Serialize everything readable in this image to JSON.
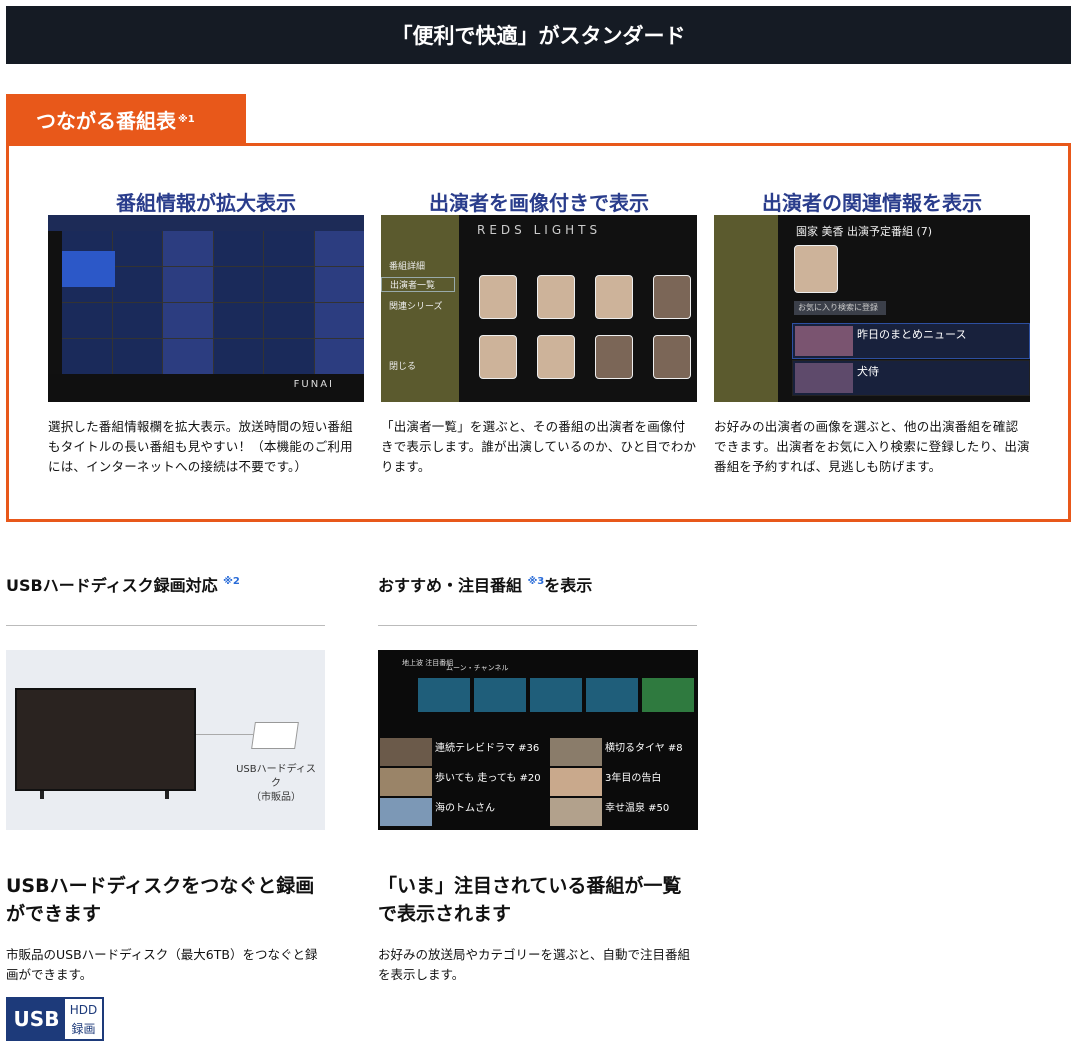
{
  "banner": {
    "title": "「便利で快適」がスタンダード"
  },
  "feature_tab": {
    "label": "つながる番組表",
    "note": "※1"
  },
  "columns": [
    {
      "heading": "番組情報が拡大表示",
      "text": "選択した番組情報欄を拡大表示。放送時間の短い番組もタイトルの長い番組も見やすい！（本機能のご利用には、インターネットへの接続は不要です。）",
      "screen": {
        "brand": "FUNAI"
      }
    },
    {
      "heading": "出演者を画像付きで表示",
      "text": "「出演者一覧」を選ぶと、その番組の出演者を画像付きで表示します。誰が出演しているのか、ひと目でわかります。",
      "screen": {
        "title": "REDS LIGHTS",
        "menu": [
          "番組詳細",
          "出演者一覧",
          "関連シリーズ",
          "閉じる"
        ]
      }
    },
    {
      "heading": "出演者の関連情報を表示",
      "text": "お好みの出演者の画像を選ぶと、他の出演番組を確認できます。出演者をお気に入り検索に登録したり、出演番組を予約すれば、見逃しも防げます。",
      "screen": {
        "title": "園家 美香 出演予定番組 (7)",
        "favorite_button": "お気に入り検索に登録",
        "programs": [
          "昨日のまとめニュース",
          "犬侍"
        ]
      }
    }
  ],
  "usb_section": {
    "title": "USBハードディスク録画対応",
    "note": "※2",
    "hdd_label_line1": "USBハードディスク",
    "hdd_label_line2": "（市販品）",
    "headline": "USBハードディスクをつなぐと録画ができます",
    "text": "市販品のUSBハードディスク（最大6TB）をつなぐと録画ができます。",
    "badge_usb": "USB",
    "badge_hdd": "HDD",
    "badge_rec": "録画"
  },
  "recommend_section": {
    "title_before": "おすすめ・注目番組 ",
    "note": "※3",
    "title_after": "を表示",
    "screen": {
      "header": "地上波 注目番組",
      "nav": "ムーン・チャンネル",
      "items": [
        "連続テレビドラマ #36",
        "横切るタイヤ #8",
        "歩いても 走っても #20",
        "3年目の告白",
        "海のトムさん",
        "幸せ温泉 #50"
      ]
    },
    "headline": "「いま」注目されている番組が一覧で表示されます",
    "text": "お好みの放送局やカテゴリーを選ぶと、自動で注目番組を表示します。"
  }
}
